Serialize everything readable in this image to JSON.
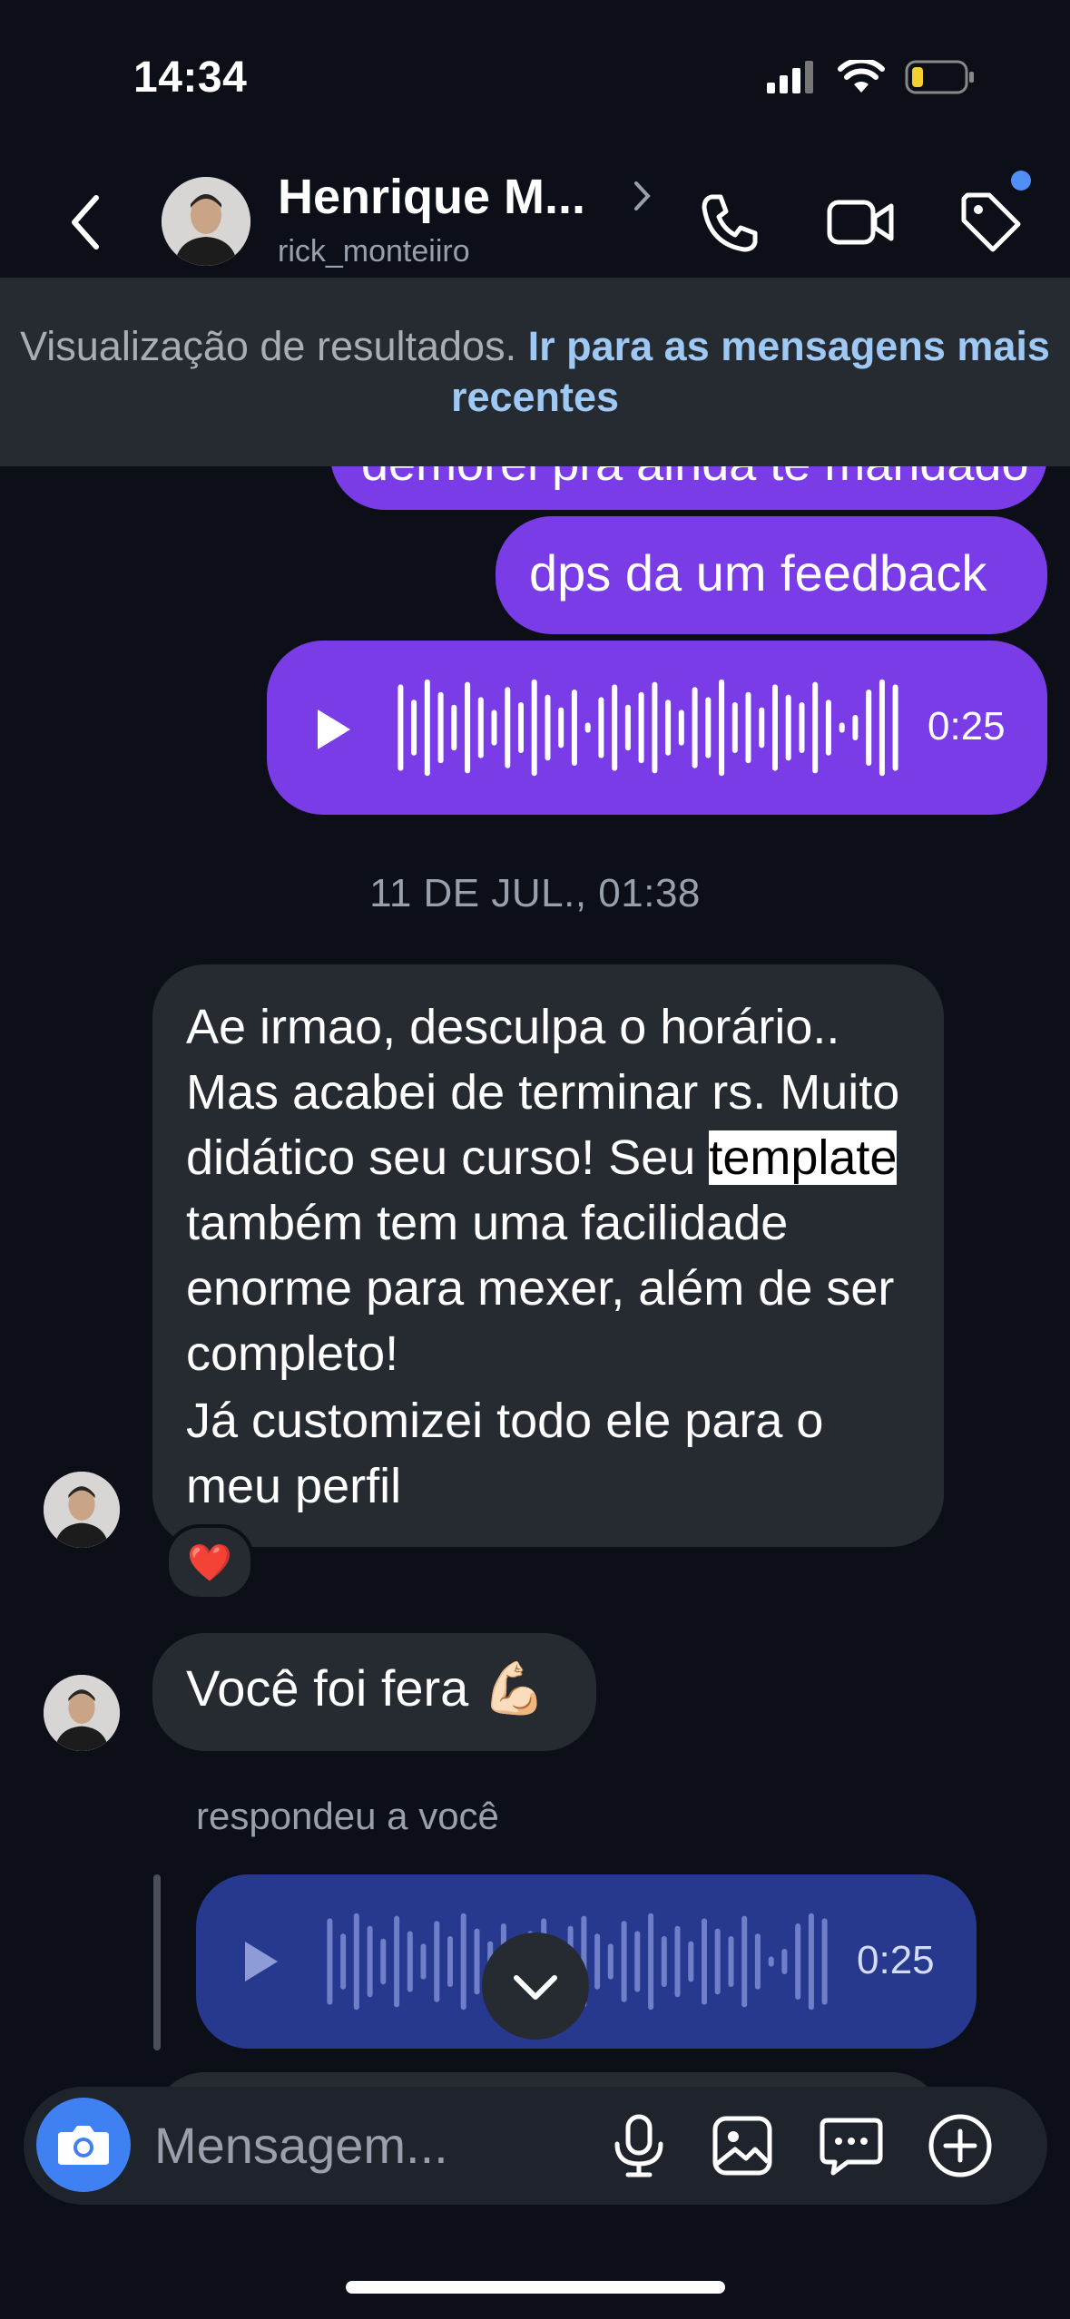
{
  "status_bar": {
    "time": "14:34"
  },
  "header": {
    "name": "Henrique M...",
    "username": "rick_monteiiro"
  },
  "banner": {
    "text": "Visualização de resultados.",
    "link": "Ir para as mensagens mais recentes"
  },
  "messages": {
    "partial_text": "demorei pra ainda te mandado",
    "feedback_text": "dps da um feedback",
    "voice_out_duration": "0:25",
    "date_separator": "11 DE JUL., 01:38",
    "long_part1": "Ae irmao, desculpa o horário.. Mas acabei de terminar rs. Muito didático seu curso! Seu ",
    "long_highlight": "template",
    "long_part2": " também tem uma facilidade enorme para mexer, além de ser completo!",
    "long_part3": "Já customizei todo ele para o meu perfil",
    "reaction": "❤️",
    "fera_text": "Você foi fera 💪🏻",
    "replied_label": "respondeu a você",
    "voice_in_duration": "0:25"
  },
  "composer": {
    "placeholder": "Mensagem..."
  },
  "colors": {
    "background": "#0c0f17",
    "outgoing_bubble": "#7a3ce6",
    "incoming_bubble": "#262a31",
    "reply_voice": "#27398e",
    "link": "#9fc9f5",
    "camera_button": "#3f80f2"
  }
}
